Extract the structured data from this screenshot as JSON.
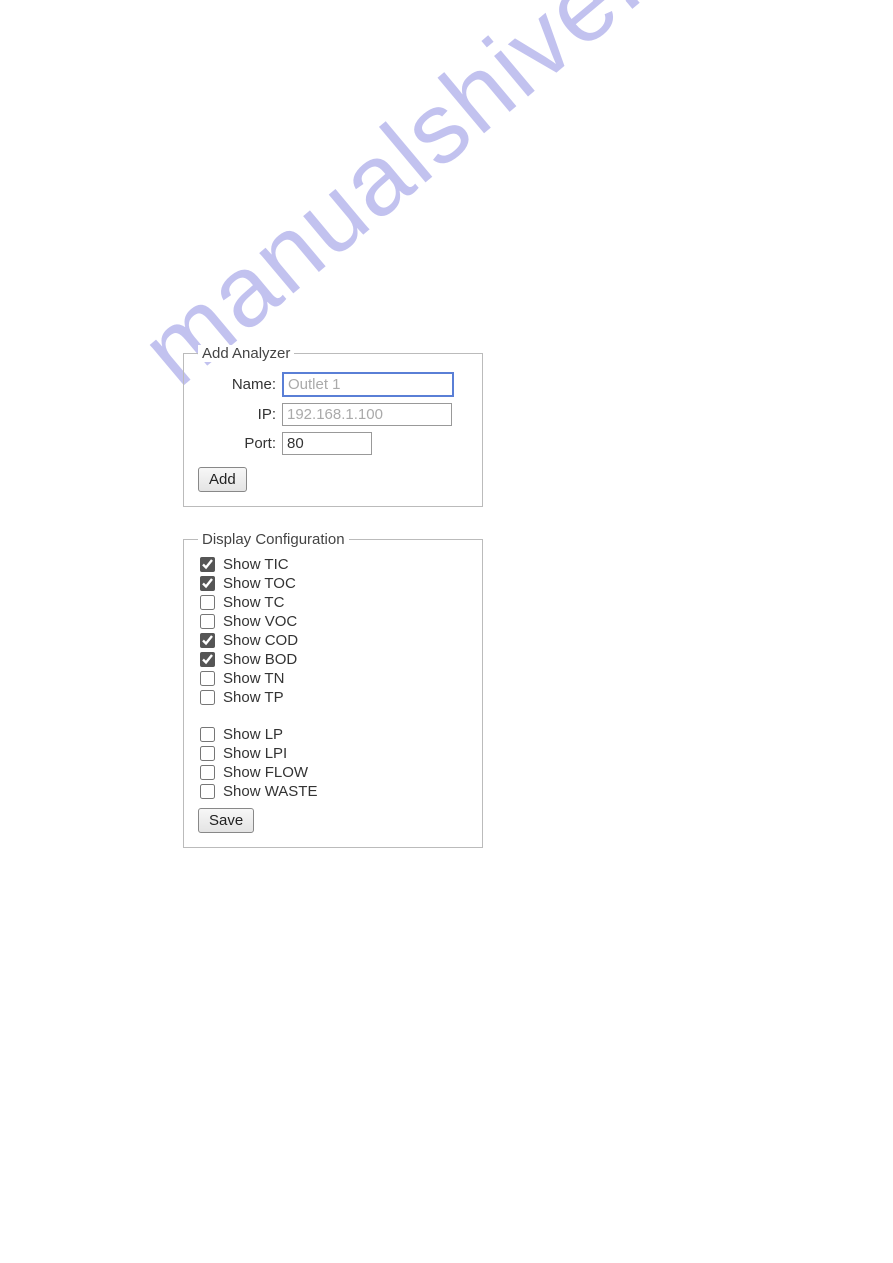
{
  "watermark": "manualshive.com",
  "addAnalyzer": {
    "legend": "Add Analyzer",
    "name": {
      "label": "Name:",
      "placeholder": "Outlet 1",
      "value": ""
    },
    "ip": {
      "label": "IP:",
      "placeholder": "192.168.1.100",
      "value": ""
    },
    "port": {
      "label": "Port:",
      "placeholder": "",
      "value": "80"
    },
    "addButton": "Add"
  },
  "displayConfig": {
    "legend": "Display Configuration",
    "group1": [
      {
        "label": "Show TIC",
        "checked": true
      },
      {
        "label": "Show TOC",
        "checked": true
      },
      {
        "label": "Show TC",
        "checked": false
      },
      {
        "label": "Show VOC",
        "checked": false
      },
      {
        "label": "Show COD",
        "checked": true
      },
      {
        "label": "Show BOD",
        "checked": true
      },
      {
        "label": "Show TN",
        "checked": false
      },
      {
        "label": "Show TP",
        "checked": false
      }
    ],
    "group2": [
      {
        "label": "Show LP",
        "checked": false
      },
      {
        "label": "Show LPI",
        "checked": false
      },
      {
        "label": "Show FLOW",
        "checked": false
      },
      {
        "label": "Show WASTE",
        "checked": false
      }
    ],
    "saveButton": "Save"
  }
}
